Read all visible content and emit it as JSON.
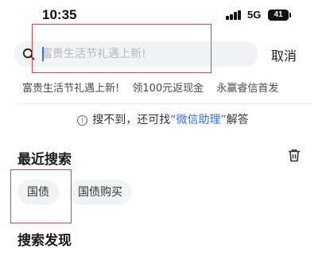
{
  "status_bar": {
    "time": "10:35",
    "network": "5G",
    "battery": "41"
  },
  "search": {
    "placeholder": "富贵生活节礼遇上新!",
    "cancel_label": "取消"
  },
  "suggestions": [
    "富贵生活节礼遇上新!",
    "领100元返现金",
    "永赢睿信首发"
  ],
  "info": {
    "prefix": "搜不到，还可找",
    "link": "“微信助理”",
    "suffix": "解答"
  },
  "recent": {
    "title": "最近搜索",
    "items": [
      "国债",
      "国债购买"
    ]
  },
  "discover": {
    "title": "搜索发现"
  },
  "colors": {
    "accent": "#2f6fed",
    "highlight": "#e34040",
    "chip_bg": "#f2f3f5"
  }
}
